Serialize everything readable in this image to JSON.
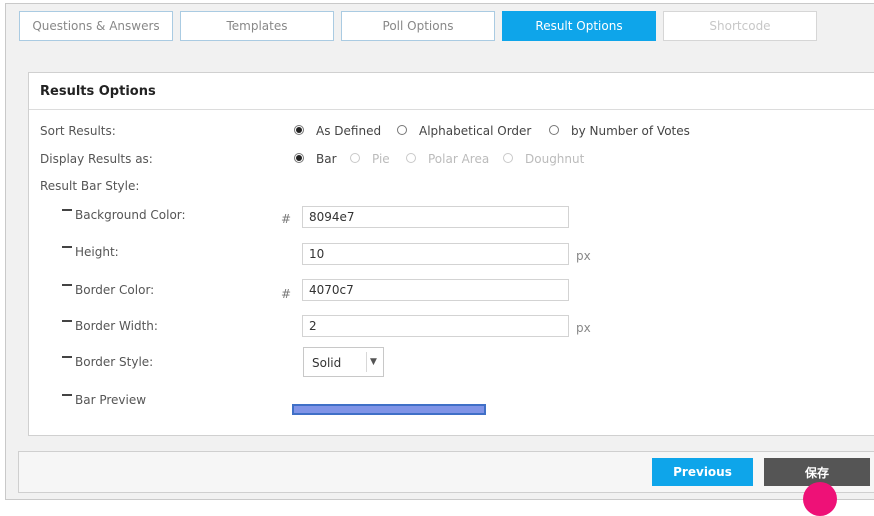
{
  "tabs": [
    {
      "label": "Questions & Answers",
      "state": "normal"
    },
    {
      "label": "Templates",
      "state": "normal"
    },
    {
      "label": "Poll Options",
      "state": "normal"
    },
    {
      "label": "Result Options",
      "state": "active"
    },
    {
      "label": "Shortcode",
      "state": "disabled"
    }
  ],
  "panel": {
    "title": "Results Options"
  },
  "sort_results": {
    "label": "Sort Results:",
    "options": [
      "As Defined",
      "Alphabetical Order",
      "by Number of Votes"
    ],
    "selected": "As Defined"
  },
  "display_results": {
    "label": "Display Results as:",
    "options": [
      "Bar",
      "Pie",
      "Polar Area",
      "Doughnut"
    ],
    "selected": "Bar"
  },
  "bar_style": {
    "label": "Result Bar Style:",
    "background_color": {
      "label": "Background Color:",
      "prefix": "#",
      "value": "8094e7"
    },
    "height": {
      "label": "Height:",
      "value": "10",
      "unit": "px"
    },
    "border_color": {
      "label": "Border Color:",
      "prefix": "#",
      "value": "4070c7"
    },
    "border_width": {
      "label": "Border Width:",
      "value": "2",
      "unit": "px"
    },
    "border_style": {
      "label": "Border Style:",
      "value": "Solid"
    },
    "bar_preview": {
      "label": "Bar Preview"
    }
  },
  "footer": {
    "previous_label": "Previous",
    "save_label": "保存"
  },
  "colors": {
    "accent": "#0ea5ea",
    "save_button": "#555555",
    "bar_fill": "#8094e7",
    "bar_border": "#4070c7",
    "cursor_dot": "#ee1177"
  }
}
